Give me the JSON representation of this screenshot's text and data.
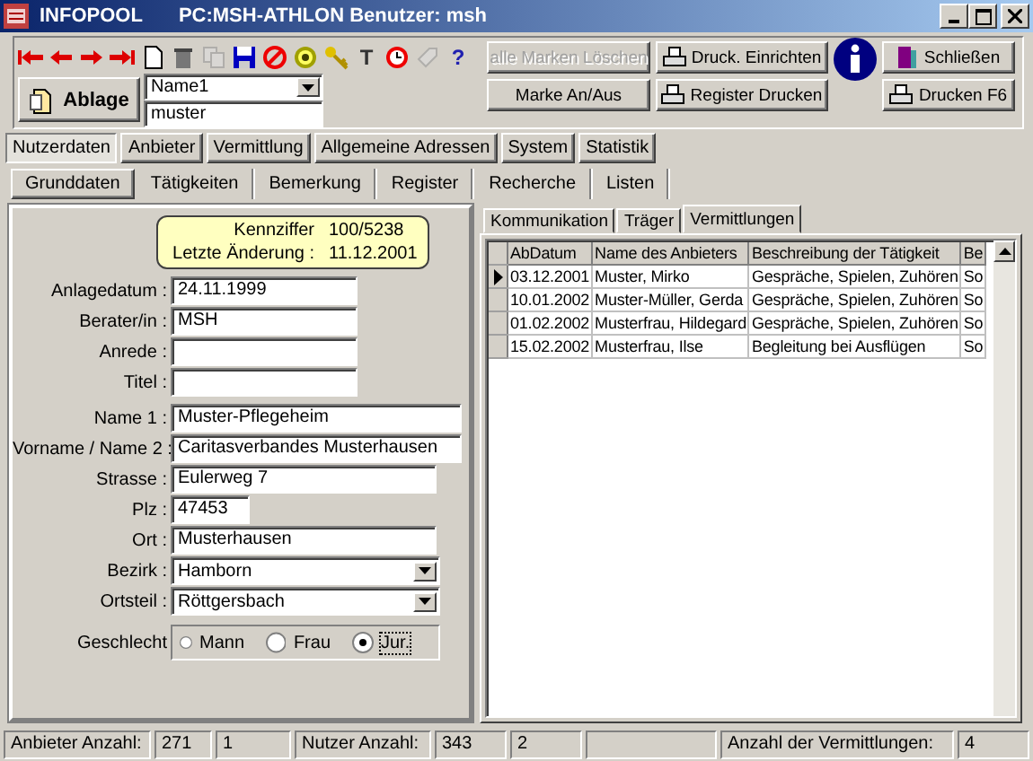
{
  "window": {
    "app": "INFOPOOL",
    "title": "PC:MSH-ATHLON Benutzer: msh"
  },
  "toolbar": {
    "icons": [
      {
        "kind": "first",
        "disabled": false
      },
      {
        "kind": "prev",
        "disabled": false
      },
      {
        "kind": "next",
        "disabled": false
      },
      {
        "kind": "last",
        "disabled": false
      },
      {
        "kind": "new",
        "disabled": false
      },
      {
        "kind": "trash",
        "disabled": false
      },
      {
        "kind": "copy",
        "disabled": true
      },
      {
        "kind": "save",
        "disabled": false
      },
      {
        "kind": "stop",
        "disabled": false
      },
      {
        "kind": "target",
        "disabled": false
      },
      {
        "kind": "key",
        "disabled": false
      },
      {
        "kind": "text",
        "glyph": "T",
        "disabled": false
      },
      {
        "kind": "clock",
        "disabled": false
      },
      {
        "kind": "tag",
        "disabled": true
      },
      {
        "kind": "help",
        "glyph": "?",
        "disabled": false
      }
    ],
    "ablage_button": "Ablage",
    "name_combo": "Name1",
    "name_field": "muster",
    "buttons": [
      {
        "label": "alle Marken Löschen",
        "kind": "plain",
        "disabled": true
      },
      {
        "label": "Marke An/Aus",
        "kind": "plain",
        "disabled": false
      },
      {
        "label": "Druck. Einrichten",
        "kind": "print",
        "disabled": false
      },
      {
        "label": "Register Drucken",
        "kind": "print",
        "disabled": false
      },
      {
        "label": "Schließen",
        "kind": "exit",
        "disabled": false
      },
      {
        "label": "Drucken F6",
        "kind": "print",
        "disabled": false
      }
    ]
  },
  "main_tabs": [
    {
      "label": "Nutzerdaten",
      "selected": true
    },
    {
      "label": "Anbieter",
      "selected": false
    },
    {
      "label": "Vermittlung",
      "selected": false
    },
    {
      "label": "Allgemeine Adressen",
      "selected": false
    },
    {
      "label": "System",
      "selected": false
    },
    {
      "label": "Statistik",
      "selected": false
    }
  ],
  "sub_tabs": [
    {
      "label": "Grunddaten",
      "selected": true
    },
    {
      "label": "Tätigkeiten",
      "selected": false
    },
    {
      "label": "Bemerkung",
      "selected": false
    },
    {
      "label": "Register",
      "selected": false
    },
    {
      "label": "Recherche",
      "selected": false
    },
    {
      "label": "Listen",
      "selected": false
    }
  ],
  "info": [
    {
      "label": "Kennziffer",
      "value": "100/5238"
    },
    {
      "label": "Letzte Änderung :",
      "value": "11.12.2001"
    }
  ],
  "fields": [
    {
      "label": "Anlagedatum :",
      "value": "24.11.1999",
      "kind": "text"
    },
    {
      "label": "Berater/in :",
      "value": "MSH",
      "kind": "text"
    },
    {
      "label": "Anrede :",
      "kind": "text"
    },
    {
      "label": "Titel :",
      "kind": "text"
    },
    {
      "label": "Name 1 :",
      "value": "Muster-Pflegeheim",
      "kind": "text"
    },
    {
      "label": "Vorname / Name 2 :",
      "value": "Caritasverbandes Musterhausen",
      "kind": "text"
    },
    {
      "label": "Strasse :",
      "value": "Eulerweg 7",
      "kind": "text"
    },
    {
      "label": "Plz :",
      "value": "47453",
      "kind": "text"
    },
    {
      "label": "Ort :",
      "value": "Musterhausen",
      "kind": "text"
    },
    {
      "label": "Bezirk :",
      "value": "Hamborn",
      "kind": "combo"
    },
    {
      "label": "Ortsteil :",
      "value": "Röttgersbach",
      "kind": "combo"
    }
  ],
  "gender": {
    "label": "Geschlecht",
    "options": [
      {
        "label": "Mann",
        "selected": false
      },
      {
        "label": "Frau",
        "selected": false
      },
      {
        "label": "Jur.",
        "selected": true
      }
    ]
  },
  "right_tabs": [
    {
      "label": "Kommunikation",
      "selected": false
    },
    {
      "label": "Träger",
      "selected": false
    },
    {
      "label": "Vermittlungen",
      "selected": true
    }
  ],
  "table": {
    "columns": [
      "AbDatum",
      "Name des Anbieters",
      "Beschreibung der Tätigkeit",
      "Be"
    ],
    "rows": [
      {
        "selected": true,
        "cells": [
          "03.12.2001",
          "Muster, Mirko",
          "Gespräche, Spielen,  Zuhören",
          "So"
        ]
      },
      {
        "selected": false,
        "cells": [
          "10.01.2002",
          "Muster-Müller, Gerda",
          "Gespräche, Spielen,  Zuhören",
          "So"
        ]
      },
      {
        "selected": false,
        "cells": [
          "01.02.2002",
          "Musterfrau, Hildegard",
          "Gespräche, Spielen,  Zuhören",
          "So"
        ]
      },
      {
        "selected": false,
        "cells": [
          "15.02.2002",
          "Musterfrau, Ilse",
          "Begleitung bei Ausflügen",
          "So"
        ]
      }
    ]
  },
  "status_bar": [
    "Anbieter Anzahl:",
    "271",
    "1",
    "Nutzer Anzahl:",
    "343",
    "2",
    "Anzahl der Vermittlungen:",
    "4"
  ]
}
